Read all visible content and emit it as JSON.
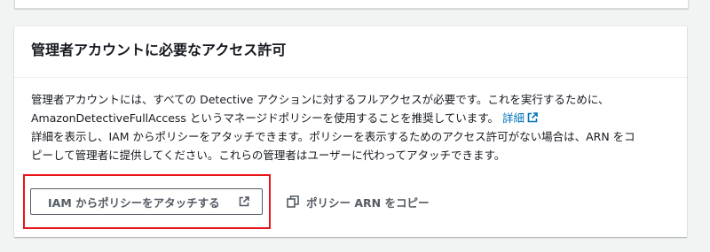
{
  "card": {
    "title": "管理者アカウントに必要なアクセス許可",
    "para1_line1": "管理者アカウントには、すべての Detective アクションに対するフルアクセスが必要です。これを実行するために、",
    "para1_line2": "AmazonDetectiveFullAccess というマネージドポリシーを使用することを推奨しています。",
    "details_link": "詳細",
    "para2_line1": "詳細を表示し、IAM からポリシーをアタッチできます。ポリシーを表示するためのアクセス許可がない場合は、ARN をコ",
    "para2_line2": "ピーして管理者に提供してください。これらの管理者はユーザーに代わってアタッチできます。"
  },
  "buttons": {
    "attach_label": "IAM からポリシーをアタッチする",
    "copy_label": "ポリシー ARN をコピー"
  },
  "icons": {
    "external_link": "external-link-icon",
    "copy": "copy-icon"
  },
  "colors": {
    "link": "#0073bb",
    "highlight": "#e8161b",
    "button_text": "#545b64"
  }
}
